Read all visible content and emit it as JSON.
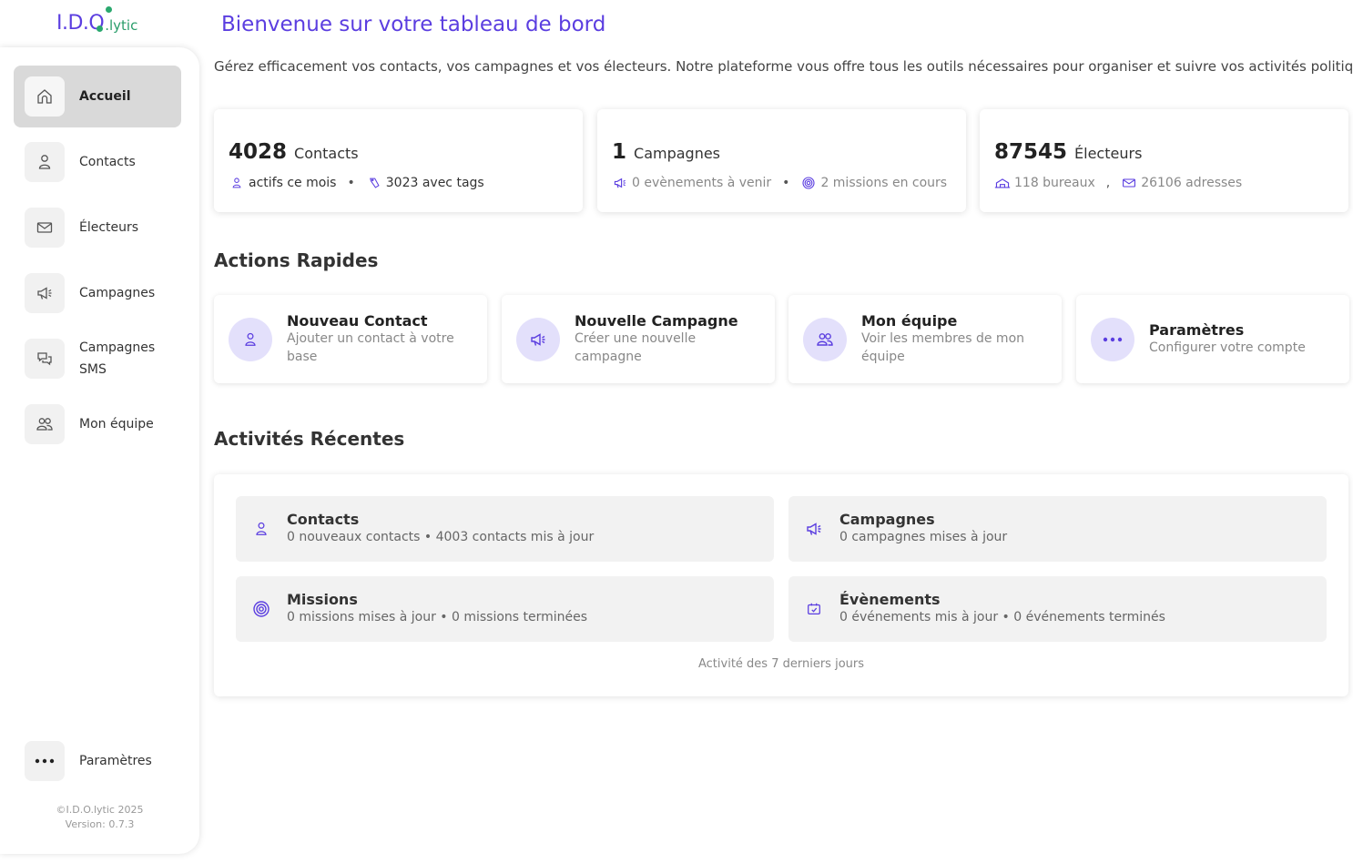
{
  "logo": {
    "main": "I.D.O",
    "suffix": ".lytic"
  },
  "sidebar": {
    "items": [
      {
        "label": "Accueil",
        "icon": "home-icon",
        "active": true
      },
      {
        "label": "Contacts",
        "icon": "user-icon"
      },
      {
        "label": "Électeurs",
        "icon": "mail-icon"
      },
      {
        "label": "Campagnes",
        "icon": "megaphone-icon"
      },
      {
        "label": "Campagnes SMS",
        "icon": "chat-icon"
      },
      {
        "label": "Mon équipe",
        "icon": "team-icon"
      }
    ],
    "settings": {
      "label": "Paramètres",
      "icon": "more-icon"
    },
    "footer": {
      "copyright": "©I.D.O.lytic 2025",
      "version": "Version: 0.7.3"
    }
  },
  "header": {
    "title": "Bienvenue sur votre tableau de bord",
    "subtitle": "Gérez efficacement vos contacts, vos campagnes et vos électeurs. Notre plateforme vous offre tous les outils nécessaires pour organiser et suivre vos activités politiques."
  },
  "stats": [
    {
      "value": "4028",
      "label": "Contacts",
      "sub1": "actifs ce mois",
      "sep": "•",
      "sub2": "3023 avec tags"
    },
    {
      "value": "1",
      "label": "Campagnes",
      "sub1": "0 evènements à venir",
      "sep": "•",
      "sub2": "2 missions en cours"
    },
    {
      "value": "87545",
      "label": "Électeurs",
      "sub1": "118 bureaux",
      "sep": ",",
      "sub2": "26106 adresses"
    }
  ],
  "actions": {
    "title": "Actions Rapides",
    "items": [
      {
        "title": "Nouveau Contact",
        "desc": "Ajouter un contact à votre base",
        "icon": "user-icon"
      },
      {
        "title": "Nouvelle Campagne",
        "desc": "Créer une nouvelle campagne",
        "icon": "megaphone-icon"
      },
      {
        "title": "Mon équipe",
        "desc": "Voir les membres de mon équipe",
        "icon": "team-icon"
      },
      {
        "title": "Paramètres",
        "desc": "Configurer votre compte",
        "icon": "more-icon"
      }
    ]
  },
  "recent": {
    "title": "Activités Récentes",
    "items": [
      {
        "title": "Contacts",
        "desc": "0 nouveaux contacts • 4003 contacts mis à jour",
        "icon": "user-icon"
      },
      {
        "title": "Campagnes",
        "desc": "0 campagnes mises à jour",
        "icon": "megaphone-icon"
      },
      {
        "title": "Missions",
        "desc": "0 missions mises à jour • 0 missions terminées",
        "icon": "target-icon"
      },
      {
        "title": "Évènements",
        "desc": "0 événements mis à jour • 0 événements terminés",
        "icon": "calendar-icon"
      }
    ],
    "note": "Activité des 7 derniers jours"
  },
  "colors": {
    "accent": "#5b3ee0",
    "accent_light": "#e3e0fb",
    "logo_green": "#2aa86e"
  }
}
